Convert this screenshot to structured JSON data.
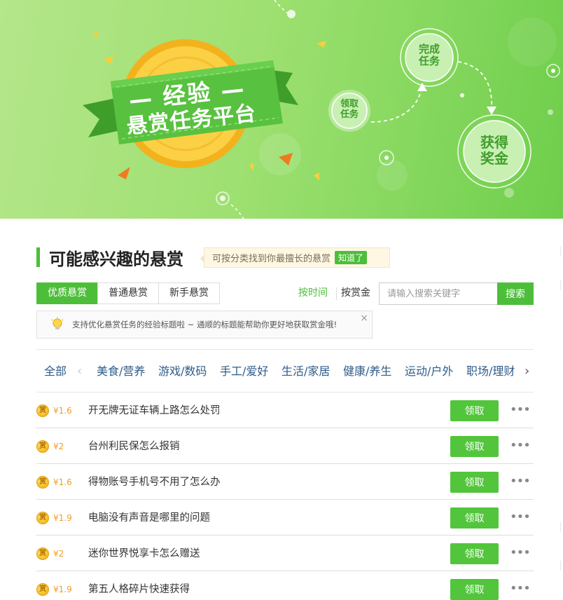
{
  "banner": {
    "ribbon_line1": "— 经验 —",
    "ribbon_line2": "悬赏任务平台",
    "step_claim": "领取\n任务",
    "step_complete": "完成\n任务",
    "step_reward": "获得\n奖金"
  },
  "section": {
    "title": "可能感兴趣的悬赏",
    "tip": "可按分类找到你最擅长的悬赏",
    "tip_ok": "知道了"
  },
  "tabs": [
    {
      "label": "优质悬赏",
      "active": true
    },
    {
      "label": "普通悬赏",
      "active": false
    },
    {
      "label": "新手悬赏",
      "active": false
    }
  ],
  "sort": {
    "by_time": "按时间",
    "by_bounty": "按赏金"
  },
  "search": {
    "placeholder": "请输入搜索关键字",
    "button": "搜索"
  },
  "notice": {
    "text": "支持优化悬赏任务的经验标题啦 ~ 通顺的标题能帮助你更好地获取赏金哦!",
    "close": "×"
  },
  "categories": {
    "all": "全部",
    "prev": "‹",
    "next": "›",
    "items": [
      "美食/营养",
      "游戏/数码",
      "手工/爱好",
      "生活/家居",
      "健康/养生",
      "运动/户外",
      "职场/理财"
    ]
  },
  "list": {
    "coin_label": "赏",
    "claim_label": "领取",
    "more_label": "•••",
    "items": [
      {
        "amount": "¥1.6",
        "title": "开无牌无证车辆上路怎么处罚"
      },
      {
        "amount": "¥2",
        "title": "台州利民保怎么报销"
      },
      {
        "amount": "¥1.6",
        "title": "得物账号手机号不用了怎么办"
      },
      {
        "amount": "¥1.9",
        "title": "电脑没有声音是哪里的问题"
      },
      {
        "amount": "¥2",
        "title": "迷你世界悦享卡怎么赠送"
      },
      {
        "amount": "¥1.9",
        "title": "第五人格碎片快速获得"
      }
    ]
  },
  "colors": {
    "accent": "#4dbe3a",
    "link": "#2e5c8a",
    "amount": "#f39c1f"
  }
}
